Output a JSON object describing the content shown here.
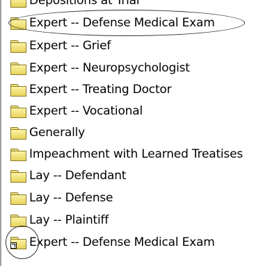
{
  "tree": {
    "items": [
      {
        "label": "Depositions at Trial",
        "icon": "folder-icon"
      },
      {
        "label": "Expert -- Defense Medical Exam",
        "icon": "folder-icon"
      },
      {
        "label": "Expert -- Grief",
        "icon": "folder-icon"
      },
      {
        "label": "Expert -- Neuropsychologist",
        "icon": "folder-icon"
      },
      {
        "label": "Expert -- Treating Doctor",
        "icon": "folder-icon"
      },
      {
        "label": "Expert -- Vocational",
        "icon": "folder-icon"
      },
      {
        "label": "Generally",
        "icon": "folder-icon"
      },
      {
        "label": "Impeachment with Learned Treatises",
        "icon": "folder-icon"
      },
      {
        "label": "Lay -- Defendant",
        "icon": "folder-icon"
      },
      {
        "label": "Lay -- Defense",
        "icon": "folder-icon"
      },
      {
        "label": "Lay -- Plaintiff",
        "icon": "folder-icon"
      },
      {
        "label": "Expert -- Defense Medical Exam",
        "icon": "folder-shortcut-icon"
      }
    ]
  },
  "colors": {
    "folder_fill": "#f0dc6a",
    "folder_outline": "#8a7a2a",
    "annotation": "#303030"
  }
}
